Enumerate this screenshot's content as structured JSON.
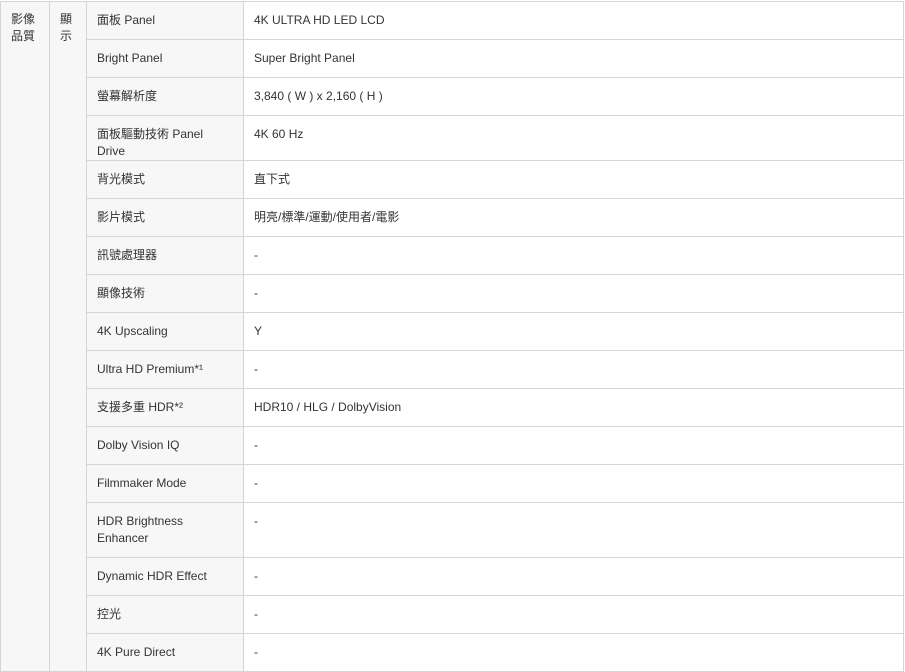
{
  "categories": {
    "level1": [
      "影像",
      "品質"
    ],
    "level2": [
      "顯",
      "示"
    ]
  },
  "rows": [
    {
      "label": "面板 Panel",
      "value": "4K ULTRA HD LED LCD"
    },
    {
      "label": "Bright Panel",
      "value": "Super Bright Panel"
    },
    {
      "label": "螢幕解析度",
      "value": "3,840 ( W ) x 2,160 ( H )"
    },
    {
      "label": "面板驅動技術 Panel Drive",
      "value": "4K 60 Hz"
    },
    {
      "label": "背光模式",
      "value": "直下式"
    },
    {
      "label": "影片模式",
      "value": "明亮/標準/運動/使用者/電影"
    },
    {
      "label": "訊號處理器",
      "value": "-"
    },
    {
      "label": "顯像技術",
      "value": "-"
    },
    {
      "label": "4K Upscaling",
      "value": "Y"
    },
    {
      "label": "Ultra HD Premium*¹",
      "value": "-"
    },
    {
      "label": "支援多重 HDR*²",
      "value": "HDR10 / HLG / DolbyVision"
    },
    {
      "label": "Dolby Vision IQ",
      "value": "-"
    },
    {
      "label": "Filmmaker Mode",
      "value": "-"
    },
    {
      "label": "HDR Brightness Enhancer",
      "value": "-"
    },
    {
      "label": "Dynamic HDR Effect",
      "value": "-"
    },
    {
      "label": "控光",
      "value": "-"
    },
    {
      "label": "4K Pure Direct",
      "value": "-"
    }
  ]
}
